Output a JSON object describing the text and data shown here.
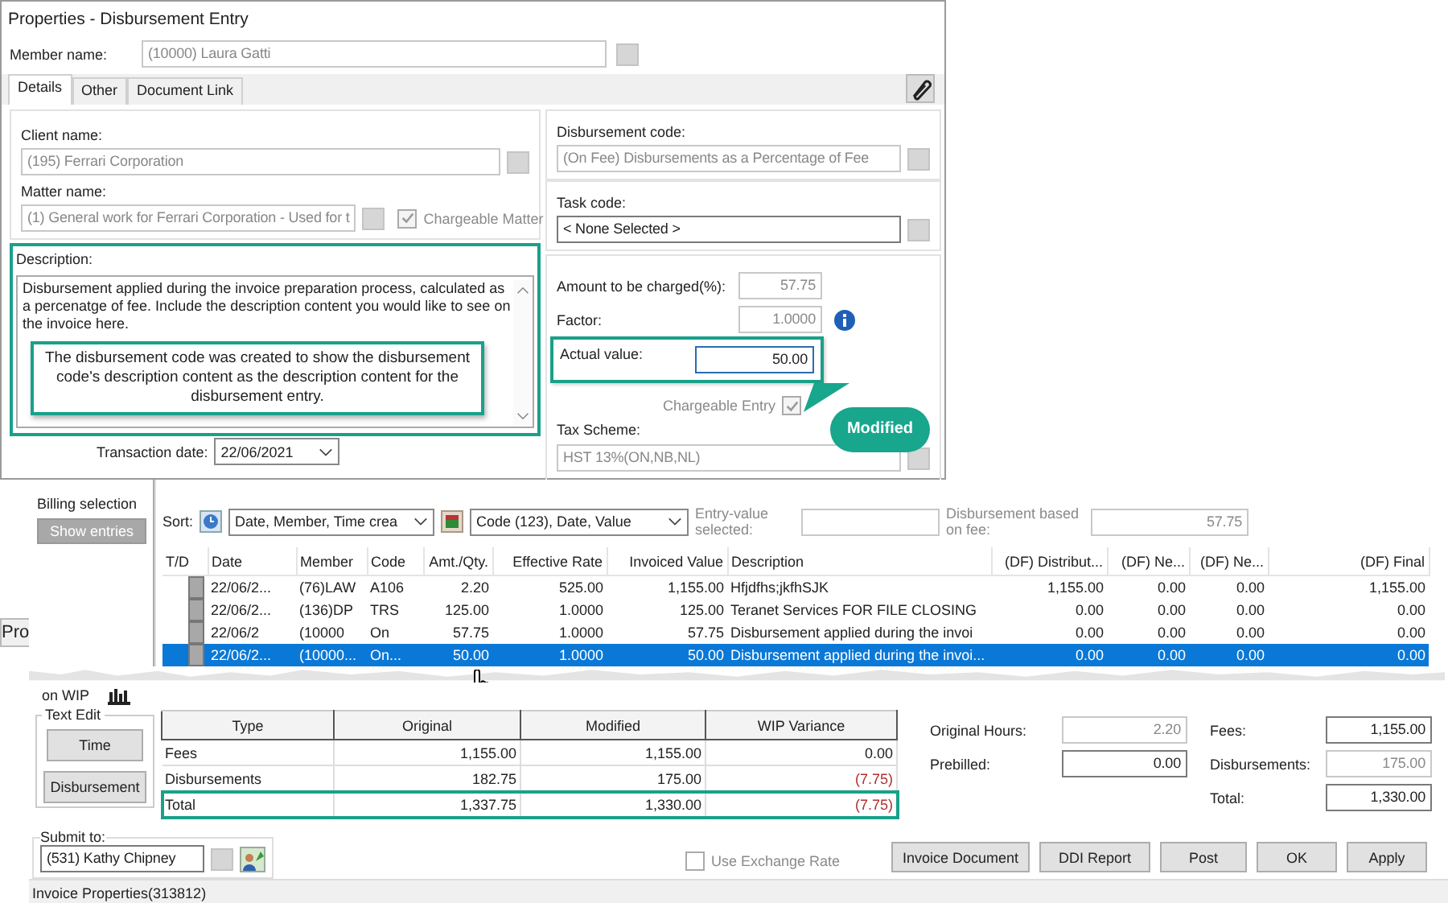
{
  "dialog": {
    "title": "Properties - Disbursement Entry",
    "member_label": "Member name:",
    "member_value": "(10000) Laura Gatti",
    "tabs": [
      {
        "label": "Details",
        "selected": true
      },
      {
        "label": "Other",
        "selected": false
      },
      {
        "label": "Document Link",
        "selected": false
      }
    ],
    "client_label": "Client name:",
    "client_value": "(195) Ferrari Corporation",
    "matter_label": "Matter name:",
    "matter_value": "(1) General work for Ferrari Corporation - Used for t",
    "chargeable_matter": {
      "label": "Chargeable Matter",
      "checked": true
    },
    "description_label": "Description:",
    "description_text": "Disbursement applied during the invoice preparation process, calculated as a percenatge of fee. Include the description content you would like to see on the invoice here.",
    "note": "The disbursement code was created to show the disbursement code's description content as the description content for the disbursement entry.",
    "transaction_date_label": "Transaction date:",
    "transaction_date": "22/06/2021",
    "disbursement_code_label": "Disbursement code:",
    "disbursement_code_value": "(On Fee) Disbursements as a Percentage of Fee",
    "task_code_label": "Task code:",
    "task_code_value": "< None Selected >",
    "amount_label": "Amount to be charged(%):",
    "amount_value": "57.75",
    "factor_label": "Factor:",
    "factor_value": "1.0000",
    "actual_label": "Actual value:",
    "actual_value": "50.00",
    "chargeable_entry": {
      "label": "Chargeable Entry",
      "checked": true
    },
    "tax_label": "Tax Scheme:",
    "tax_value": "HST 13%(ON,NB,NL)",
    "callout": "Modified"
  },
  "background_fragment": "Pro",
  "billing": {
    "title": "Billing selection",
    "show_entries": "Show entries",
    "sort_label": "Sort:",
    "sort_primary": "Date, Member, Time crea",
    "sort_secondary": "Code (123), Date, Value",
    "entry_value_label": "Entry-value selected:",
    "disbursement_label": "Disbursement based on fee:",
    "disbursement_value": "57.75",
    "columns": [
      "T/D",
      "Date",
      "Member",
      "Code",
      "Amt./Qty.",
      "Effective Rate",
      "Invoiced Value",
      "Description",
      "(DF) Distribut...",
      "(DF) Ne...",
      "(DF) Ne...",
      "(DF) Final"
    ],
    "rows": [
      {
        "selected": false,
        "cells": [
          "",
          "22/06/2...",
          "(76)LAW",
          "A106",
          "2.20",
          "525.00",
          "1,155.00",
          "Hfjdfhs;jkfhSJK",
          "1,155.00",
          "0.00",
          "0.00",
          "1,155.00"
        ]
      },
      {
        "selected": false,
        "cells": [
          "",
          "22/06/2...",
          "(136)DP",
          "TRS",
          "125.00",
          "1.0000",
          "125.00",
          "Teranet Services FOR FILE CLOSING",
          "0.00",
          "0.00",
          "0.00",
          "0.00"
        ]
      },
      {
        "selected": false,
        "cells": [
          "",
          "22/06/2",
          "(10000",
          "On",
          "57.75",
          "1.0000",
          "57.75",
          "Disbursement applied during the invoi",
          "0.00",
          "0.00",
          "0.00",
          "0.00"
        ]
      },
      {
        "selected": true,
        "cells": [
          "",
          "22/06/2...",
          "(10000...",
          "On...",
          "50.00",
          "1.0000",
          "50.00",
          "Disbursement applied during the invoi...",
          "0.00",
          "0.00",
          "0.00",
          "0.00"
        ]
      }
    ]
  },
  "invoice": {
    "wip_label": "on WIP",
    "text_edit_label": "Text Edit",
    "text_edit_buttons": [
      "Time",
      "Disbursement"
    ],
    "summary_columns": [
      "Type",
      "Original",
      "Modified",
      "WIP Variance"
    ],
    "summary_rows": [
      {
        "cells": [
          "Fees",
          "1,155.00",
          "1,155.00",
          "0.00"
        ],
        "negative": false,
        "highlighted": false
      },
      {
        "cells": [
          "Disbursements",
          "182.75",
          "175.00",
          "(7.75)"
        ],
        "negative": true,
        "highlighted": false
      },
      {
        "cells": [
          "Total",
          "1,337.75",
          "1,330.00",
          "(7.75)"
        ],
        "negative": true,
        "highlighted": true
      }
    ],
    "original_hours_label": "Original Hours:",
    "original_hours": "2.20",
    "prebilled_label": "Prebilled:",
    "prebilled": "0.00",
    "fees_label": "Fees:",
    "fees": "1,155.00",
    "disbursements_label": "Disbursements:",
    "disbursements": "175.00",
    "total_label": "Total:",
    "total": "1,330.00",
    "submit_label": "Submit to:",
    "submit_value": "(531) Kathy Chipney",
    "exchange_rate": {
      "label": "Use Exchange Rate",
      "checked": false
    },
    "buttons": [
      "Invoice Document",
      "DDI Report",
      "Post",
      "OK",
      "Apply"
    ],
    "status": "Invoice Properties(313812)"
  }
}
